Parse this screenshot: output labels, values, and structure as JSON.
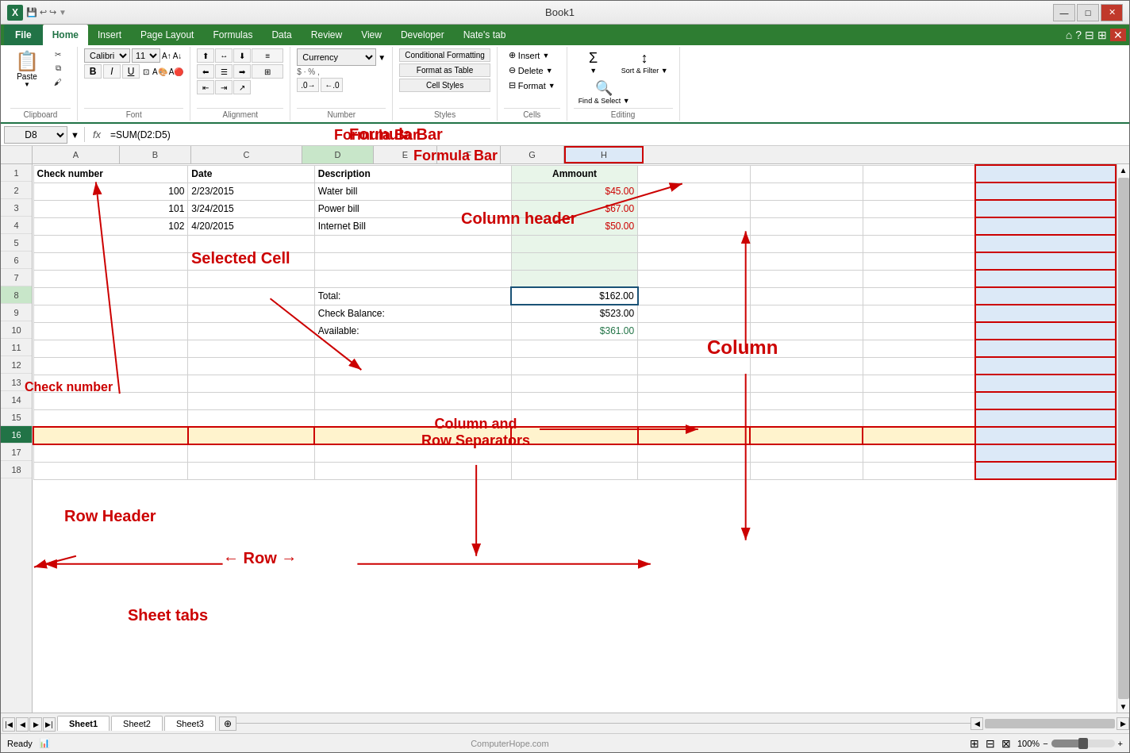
{
  "titleBar": {
    "title": "Book1",
    "xlIcon": "X",
    "minBtn": "—",
    "maxBtn": "□",
    "closeBtn": "✕"
  },
  "ribbon": {
    "tabs": [
      "File",
      "Home",
      "Insert",
      "Page Layout",
      "Formulas",
      "Data",
      "Review",
      "View",
      "Developer",
      "Nate's tab"
    ],
    "activeTab": "Home",
    "groups": {
      "clipboard": {
        "label": "Clipboard"
      },
      "font": {
        "label": "Font",
        "name": "Calibri",
        "size": "11"
      },
      "alignment": {
        "label": "Alignment"
      },
      "number": {
        "label": "Number",
        "format": "Currency"
      },
      "styles": {
        "label": "Styles"
      },
      "cells": {
        "label": "Cells"
      },
      "editing": {
        "label": "Editing"
      }
    }
  },
  "formulaBar": {
    "cellRef": "D8",
    "formula": "=SUM(D2:D5)",
    "fxLabel": "fx",
    "annotation": "Formula Bar"
  },
  "columns": [
    "A",
    "B",
    "C",
    "D",
    "E",
    "F",
    "G",
    "H"
  ],
  "rows": [
    {
      "num": 1,
      "cells": [
        "Check number",
        "Date",
        "Description",
        "Ammount",
        "",
        "",
        "",
        ""
      ]
    },
    {
      "num": 2,
      "cells": [
        "100",
        "2/23/2015",
        "Water bill",
        "$45.00",
        "",
        "",
        "",
        ""
      ]
    },
    {
      "num": 3,
      "cells": [
        "101",
        "3/24/2015",
        "Power bill",
        "$67.00",
        "",
        "",
        "",
        ""
      ]
    },
    {
      "num": 4,
      "cells": [
        "102",
        "4/20/2015",
        "Internet Bill",
        "$50.00",
        "",
        "",
        "",
        ""
      ]
    },
    {
      "num": 5,
      "cells": [
        "",
        "",
        "",
        "",
        "",
        "",
        "",
        ""
      ]
    },
    {
      "num": 6,
      "cells": [
        "",
        "",
        "",
        "",
        "",
        "",
        "",
        ""
      ]
    },
    {
      "num": 7,
      "cells": [
        "",
        "",
        "",
        "",
        "",
        "",
        "",
        ""
      ]
    },
    {
      "num": 8,
      "cells": [
        "",
        "",
        "Total:",
        "$162.00",
        "",
        "",
        "",
        ""
      ]
    },
    {
      "num": 9,
      "cells": [
        "",
        "",
        "Check Balance:",
        "$523.00",
        "",
        "",
        "",
        ""
      ]
    },
    {
      "num": 10,
      "cells": [
        "",
        "",
        "Available:",
        "$361.00",
        "",
        "",
        "",
        ""
      ]
    },
    {
      "num": 11,
      "cells": [
        "",
        "",
        "",
        "",
        "",
        "",
        "",
        ""
      ]
    },
    {
      "num": 12,
      "cells": [
        "",
        "",
        "",
        "",
        "",
        "",
        "",
        ""
      ]
    },
    {
      "num": 13,
      "cells": [
        "",
        "",
        "",
        "",
        "",
        "",
        "",
        ""
      ]
    },
    {
      "num": 14,
      "cells": [
        "",
        "",
        "",
        "",
        "",
        "",
        "",
        ""
      ]
    },
    {
      "num": 15,
      "cells": [
        "",
        "",
        "",
        "",
        "",
        "",
        "",
        ""
      ]
    },
    {
      "num": 16,
      "cells": [
        "",
        "",
        "",
        "",
        "",
        "",
        "",
        ""
      ]
    },
    {
      "num": 17,
      "cells": [
        "",
        "",
        "",
        "",
        "",
        "",
        "",
        ""
      ]
    },
    {
      "num": 18,
      "cells": [
        "",
        "",
        "",
        "",
        "",
        "",
        "",
        ""
      ]
    }
  ],
  "annotations": {
    "checkNumber": "Check number",
    "selectedCell": "Selected Cell",
    "columnHeader": "Column header",
    "column": "Column",
    "columnRowSeparators": "Column and\nRow Separators",
    "rowHeader": "Row Header",
    "row": "← Row →",
    "sheetTabs": "Sheet tabs"
  },
  "sheetTabs": [
    "Sheet1",
    "Sheet2",
    "Sheet3"
  ],
  "activeSheet": "Sheet1",
  "statusBar": {
    "ready": "Ready",
    "zoom": "100%"
  }
}
